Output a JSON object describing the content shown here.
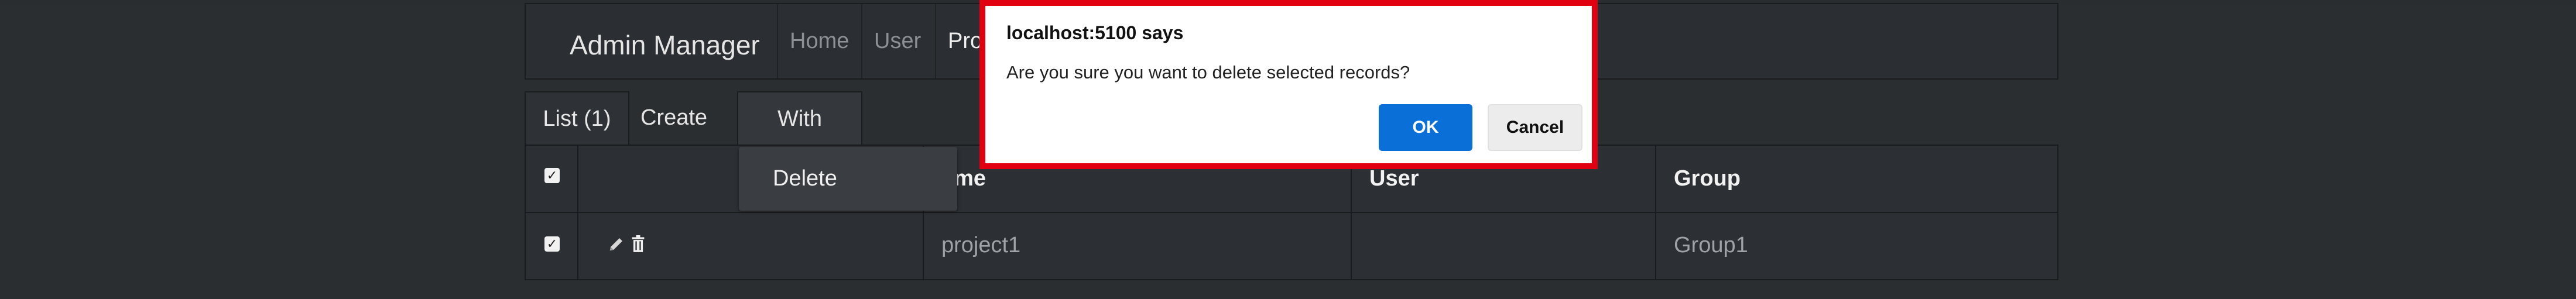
{
  "app": {
    "brand": "Admin Manager"
  },
  "nav": {
    "home": "Home",
    "user": "User",
    "project": "Proje"
  },
  "tabs": {
    "list": "List (1)",
    "create": "Create",
    "with_selected": "With selected"
  },
  "dropdown": {
    "delete": "Delete"
  },
  "table": {
    "headers": [
      "",
      "",
      "ame",
      "User",
      "Group"
    ],
    "rows": [
      {
        "checked": true,
        "name": "project1",
        "user": "",
        "group": "Group1"
      }
    ]
  },
  "dialog": {
    "title": "localhost:5100 says",
    "message": "Are you sure you want to delete selected records?",
    "ok": "OK",
    "cancel": "Cancel"
  },
  "colors": {
    "background": "#2b2e31",
    "ok_button": "#0b6fd8",
    "dialog_border": "#e00010"
  }
}
